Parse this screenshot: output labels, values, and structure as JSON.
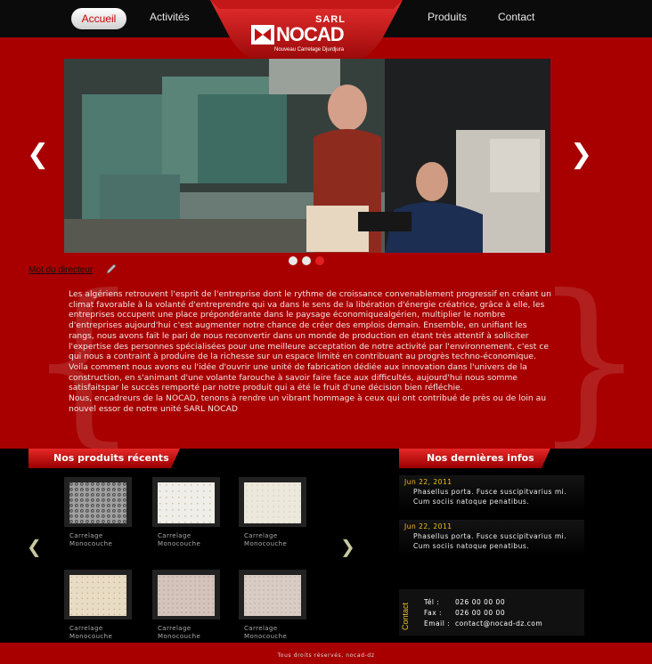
{
  "nav": {
    "accueil": "Accueil",
    "activites": "Activités",
    "produits": "Produits",
    "contact": "Contact"
  },
  "logo": {
    "sarl": "SARL",
    "name": "NOCAD",
    "tagline": "Nouveau Carrelage Djurdjura"
  },
  "slider": {
    "prev_icon": "❮",
    "next_icon": "❯",
    "active_dot": 3
  },
  "director": {
    "title": "Mot du directeur",
    "text": "Les algériens retrouvent l'esprit de l'entreprise dont le rythme de croissance convenablement progressif en créant un climat  favorable à la volanté d'entreprendre qui va dans le sens de la libération d'énergie créatrice, grâce à elle, les entreprises  occupent une place prépondérante dans le paysage économiquealgérien, multiplier le nombre d'entreprises aujourd'hui c'est  augmenter notre chance de créer des emplois demain. Ensemble, en unifiant les rangs, nous avons fait le pari de nous reconvertir dans un monde de production  en étant très attentif à solliciter l'expertise des personnes spécialisées pour une meilleure acceptation de notre activité par l'environnement, c'est ce qui nous a contraint à produire de la richesse sur un espace limité en contribuant au progrès techno-économique.\nVoila comment nous avons eu l'idée d'ouvrir une unité de fabrication dédiée aux innovation dans l'univers de  la construction, en s'animant d'une volante farouche à savoir faire face aux difficultés, aujourd'hui nous somme satisfaitspar le succès remporté par notre produit qui a été le fruit d'une décision bien réfléchie.\nNous, encadreurs de la NOCAD, tenons à rendre un vibrant hommage à ceux qui ont contribué de près ou de loin au nouvel essor de notre unité SARL NOCAD"
  },
  "products": {
    "title": "Nos produits récents",
    "prev_icon": "❮",
    "next_icon": "❯",
    "items": [
      {
        "line1": "Carrelage",
        "line2": "Monocouche"
      },
      {
        "line1": "Carrelage",
        "line2": "Monocouche"
      },
      {
        "line1": "Carrelage",
        "line2": "Monocouche"
      },
      {
        "line1": "Carrelage",
        "line2": "Monocouche"
      },
      {
        "line1": "Carrelage",
        "line2": "Monocouche"
      },
      {
        "line1": "Carrelage",
        "line2": "Monocouche"
      }
    ]
  },
  "news": {
    "title": "Nos dernières infos",
    "items": [
      {
        "date": "Jun 22, 2011",
        "text": "Phasellus porta. Fusce suscipitvarius mi. Cum sociis natoque penatibus."
      },
      {
        "date": "Jun 22, 2011",
        "text": "Phasellus porta. Fusce suscipitvarius mi. Cum sociis natoque penatibus."
      }
    ]
  },
  "contact": {
    "title": "Contact",
    "tel_label": "Tél :",
    "tel": "026 00 00 00",
    "fax_label": "Fax :",
    "fax": "026 00 00 00",
    "email_label": "Email :",
    "email": "contact@nocad-dz.com"
  },
  "footer": {
    "text": "Tous droits réservés, nocad-dz"
  },
  "colors": {
    "brand_red": "#a80000",
    "accent_yellow": "#f0c020"
  }
}
